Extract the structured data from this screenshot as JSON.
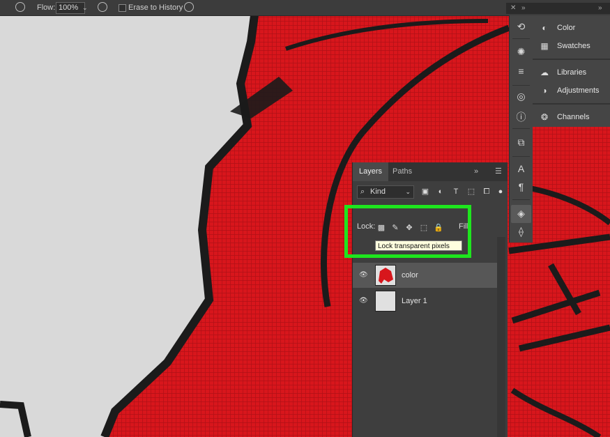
{
  "options_bar": {
    "flow_label": "Flow:",
    "flow_value": "100%",
    "erase_to_history_label": "Erase to History"
  },
  "right_panels": {
    "items": [
      {
        "label": "Color",
        "icon": "color-wheel-icon"
      },
      {
        "label": "Swatches",
        "icon": "swatches-grid-icon"
      },
      {
        "label": "Libraries",
        "icon": "libraries-icon"
      },
      {
        "label": "Adjustments",
        "icon": "adjustments-icon"
      },
      {
        "label": "Channels",
        "icon": "channels-icon"
      }
    ]
  },
  "layers_panel": {
    "tabs": [
      {
        "label": "Layers",
        "active": true
      },
      {
        "label": "Paths",
        "active": false
      }
    ],
    "filter_kind": "Kind",
    "lock_label": "Lock:",
    "fill_label": "Fill:",
    "tooltip": "Lock transparent pixels",
    "layers": [
      {
        "name": "color",
        "selected": true
      },
      {
        "name": "Layer 1",
        "selected": false
      }
    ]
  },
  "colors": {
    "canvas_red": "#d8161c",
    "canvas_gray": "#d9d9d9",
    "highlight_green": "#1ee61e",
    "panel_bg": "#3e3e3e"
  }
}
